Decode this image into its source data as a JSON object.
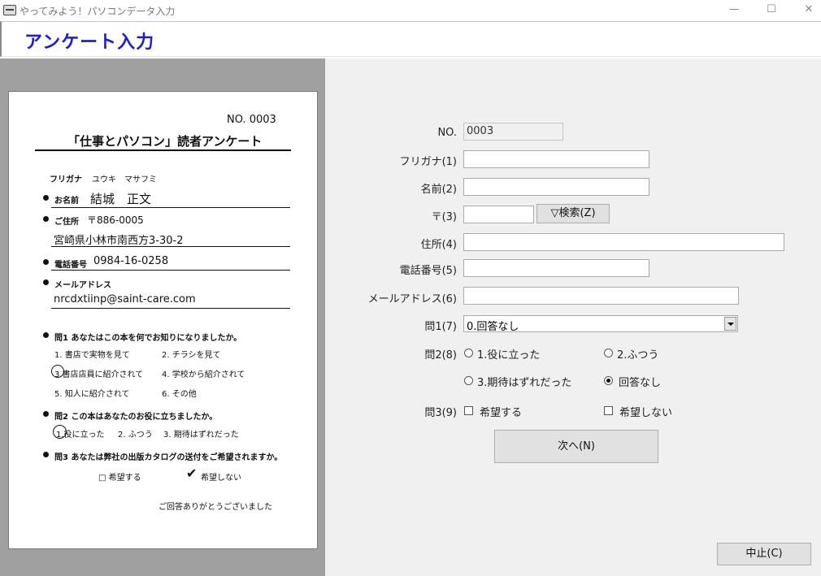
{
  "window": {
    "title": "やってみよう！パソコンデータ入力",
    "minimize": "—",
    "maximize": "☐",
    "close": "✕"
  },
  "header": {
    "title": "アンケート入力"
  },
  "paper": {
    "no": "NO. 0003",
    "title": "「仕事とパソコン」読者アンケート",
    "furigana_label": "フリガナ",
    "furigana_value": "ユウキ　マサフミ",
    "name_label": "お名前",
    "name_value": "結城　正文",
    "address_label": "ご住所",
    "zip_value": "〒886-0005",
    "address_value": "宮崎県小林市南西方3-30-2",
    "phone_label": "電話番号",
    "phone_value": "0984-16-0258",
    "email_label": "メールアドレス",
    "email_value": "nrcdxtiinp@saint-care.com",
    "q1_label": "問1 あなたはこの本を何でお知りになりましたか。",
    "q1_options": [
      "1. 書店で実物を見て",
      "2. チラシを見て",
      "3.書店店員に紹介されて",
      "4. 学校から紹介されて",
      "5. 知人に紹介されて",
      "6. その他"
    ],
    "q2_label": "問2 この本はあなたのお役に立ちましたか。",
    "q2_options": [
      "1.役に立った",
      "2. ふつう",
      "3. 期待はずれだった"
    ],
    "q3_label": "問3 あなたは弊社の出版カタログの送付をご希望されますか。",
    "q3_options": [
      "□ 希望する",
      "希望しない"
    ],
    "q3_check": "✔",
    "thanks": "ご回答ありがとうございました"
  },
  "form": {
    "no_label": "NO.",
    "no_value": "0003",
    "furigana_label": "フリガナ(1)",
    "name_label": "名前(2)",
    "zip_label": "〒(3)",
    "search_button": "▽検索(Z)",
    "address_label": "住所(4)",
    "phone_label": "電話番号(5)",
    "email_label": "メールアドレス(6)",
    "q1_label": "問1(7)",
    "q1_value": "0.回答なし",
    "q2_label": "問2(8)",
    "q2_options": [
      "1.役に立った",
      "2.ふつう",
      "3.期待はずれだった",
      "回答なし"
    ],
    "q3_label": "問3(9)",
    "q3_options": [
      "希望する",
      "希望しない"
    ],
    "next_button": "次へ(N)",
    "cancel_button": "中止(C)"
  }
}
